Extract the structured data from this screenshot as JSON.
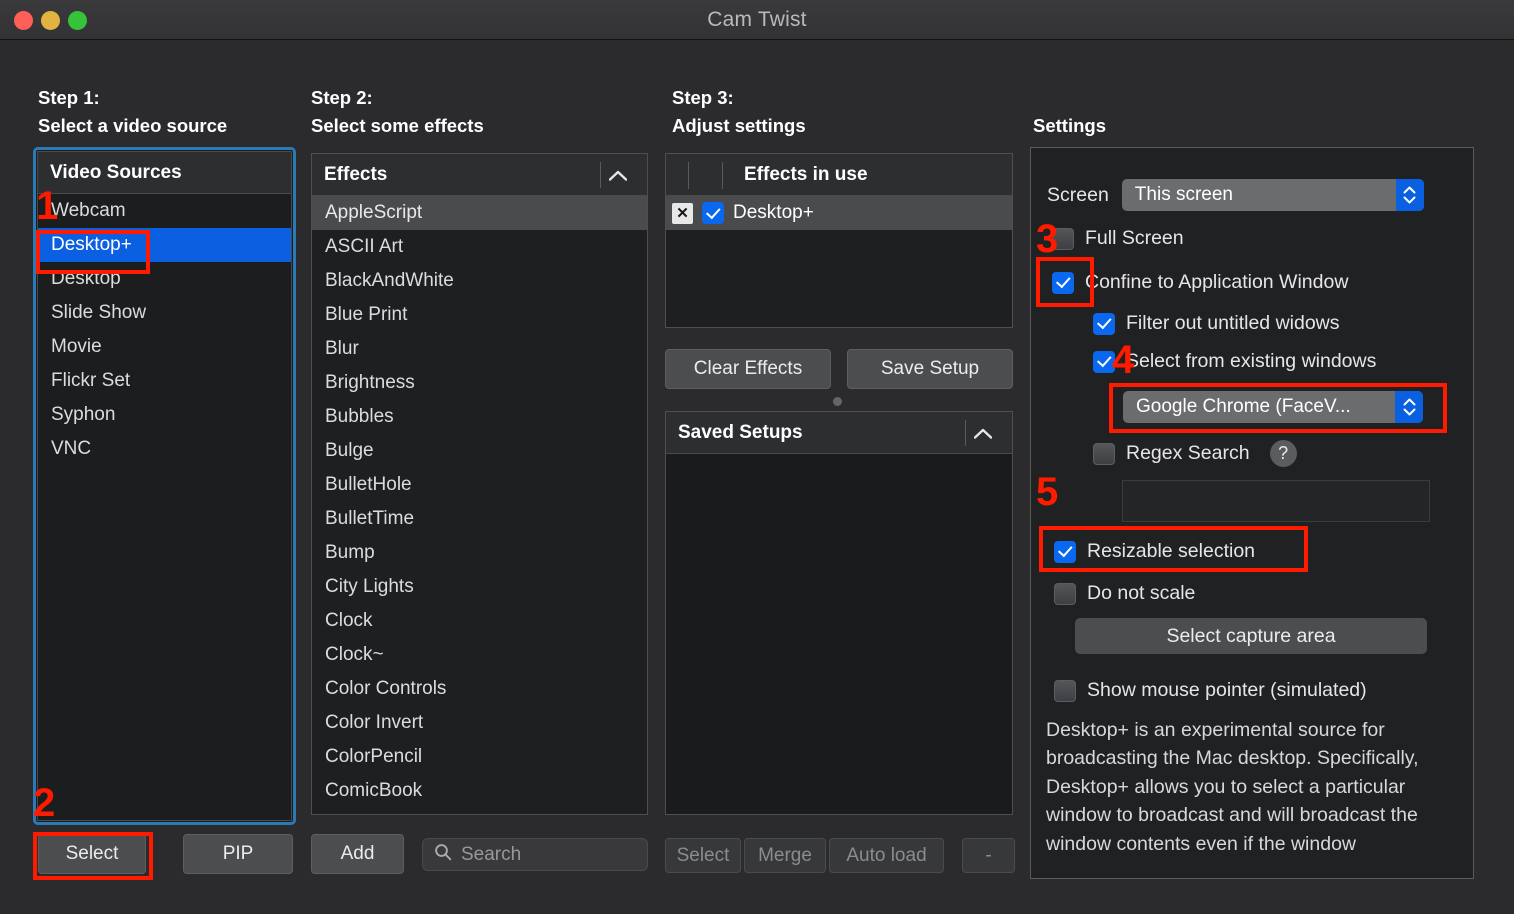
{
  "window": {
    "title": "Cam Twist",
    "traffic_lights": [
      "close-red",
      "minimize-yellow",
      "zoom-green"
    ]
  },
  "columns": {
    "step1": "Step 1:\nSelect a video source",
    "step2": "Step 2:\nSelect some effects",
    "step3": "Step 3:\nAdjust settings",
    "settings": "Settings"
  },
  "video_sources": {
    "header": "Video Sources",
    "items": [
      "Webcam",
      "Desktop+",
      "Desktop",
      "Slide Show",
      "Movie",
      "Flickr Set",
      "Syphon",
      "VNC"
    ],
    "selected": "Desktop+"
  },
  "effects": {
    "header": "Effects",
    "items": [
      "AppleScript",
      "ASCII Art",
      "BlackAndWhite",
      "Blue Print",
      "Blur",
      "Brightness",
      "Bubbles",
      "Bulge",
      "BulletHole",
      "BulletTime",
      "Bump",
      "City Lights",
      "Clock",
      "Clock~",
      "Color Controls",
      "Color Invert",
      "ColorPencil",
      "ComicBook"
    ],
    "highlighted": "AppleScript"
  },
  "effects_in_use": {
    "header": "Effects in use",
    "rows": [
      {
        "label": "Desktop+",
        "enabled": true,
        "remove_glyph": "⌧"
      }
    ],
    "clear_label": "Clear Effects",
    "save_label": "Save Setup"
  },
  "saved_setups": {
    "header": "Saved Setups",
    "items": [],
    "select_label": "Select",
    "merge_label": "Merge",
    "auto_load_label": "Auto load",
    "minus_label": "-"
  },
  "settings": {
    "screen_label": "Screen",
    "screen_value": "This screen",
    "full_screen": {
      "label": "Full Screen",
      "checked": false
    },
    "confine_window": {
      "label": "Confine to Application Window",
      "checked": true
    },
    "filter_untitled": {
      "label": "Filter out untitled widows",
      "checked": true
    },
    "select_existing": {
      "label": "Select from existing windows",
      "checked": true
    },
    "window_value": "Google Chrome (FaceV...",
    "regex_search": {
      "label": "Regex Search",
      "checked": false
    },
    "help_glyph": "?",
    "regex_value": "",
    "resizable_selection": {
      "label": "Resizable selection",
      "checked": true
    },
    "do_not_scale": {
      "label": "Do not scale",
      "checked": false
    },
    "select_capture_area": "Select capture area",
    "show_mouse_pointer": {
      "label": "Show mouse pointer (simulated)",
      "checked": false
    },
    "description": "Desktop+ is an experimental source for broadcasting the Mac desktop. Specifically, Desktop+ allows you to select a particular window to broadcast and will broadcast the window contents even if the window"
  },
  "bottom_bar": {
    "select_label": "Select",
    "pip_label": "PIP",
    "add_label": "Add",
    "search_placeholder": "Search"
  },
  "annotations": {
    "accent_color": "#ff1a00",
    "markers": [
      "1",
      "2",
      "3",
      "4",
      "5"
    ]
  }
}
